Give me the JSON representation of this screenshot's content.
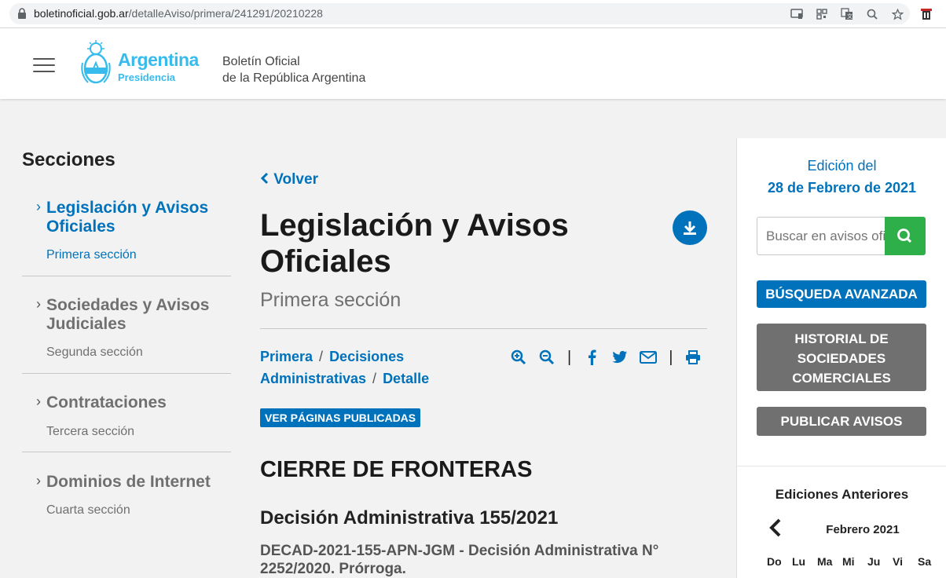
{
  "browser": {
    "url_domain": "boletinoficial.gob.ar",
    "url_path": "/detalleAviso/primera/241291/20210228"
  },
  "header": {
    "logo_title": "Argentina",
    "logo_sub": "Presidencia",
    "site_title_line1": "Boletín Oficial",
    "site_title_line2": "de la República Argentina"
  },
  "sidebar": {
    "title": "Secciones",
    "items": [
      {
        "label": "Legislación y Avisos Oficiales",
        "sub": "Primera sección",
        "active": true
      },
      {
        "label": "Sociedades y Avisos Judiciales",
        "sub": "Segunda sección",
        "active": false
      },
      {
        "label": "Contrataciones",
        "sub": "Tercera sección",
        "active": false
      },
      {
        "label": "Dominios de Internet",
        "sub": "Cuarta sección",
        "active": false
      }
    ]
  },
  "main": {
    "back_label": "Volver",
    "title": "Legislación y Avisos Oficiales",
    "subtitle": "Primera sección",
    "breadcrumb": [
      "Primera",
      "Decisiones Administrativas",
      "Detalle"
    ],
    "pages_button": "VER PÁGINAS PUBLICADAS",
    "heading": "CIERRE DE FRONTERAS",
    "decision": "Decisión Administrativa 155/2021",
    "decad": "DECAD-2021-155-APN-JGM - Decisión Administrativa N° 2252/2020. Prórroga."
  },
  "right_panel": {
    "edition_label": "Edición del",
    "edition_date": "28 de Febrero de 2021",
    "search_placeholder": "Buscar en avisos oficiales",
    "btn_advanced": "BÚSQUEDA AVANZADA",
    "btn_history": "HISTORIAL DE SOCIEDADES COMERCIALES",
    "btn_publish": "PUBLICAR AVISOS",
    "previous_editions": "Ediciones Anteriores",
    "calendar_month": "Febrero 2021",
    "weekdays": [
      "Do",
      "Lu",
      "Ma",
      "Mi",
      "Ju",
      "Vi",
      "Sa"
    ]
  },
  "colors": {
    "primary": "#0072bb",
    "success": "#2eaf49",
    "grey_button": "#707070",
    "logo": "#37bbed"
  },
  "icons": [
    "lock-icon",
    "cast-icon",
    "qr-icon",
    "translate-icon",
    "zoom-icon",
    "star-icon",
    "extension-icon",
    "hamburger-icon",
    "download-icon",
    "zoom-in-icon",
    "zoom-out-icon",
    "facebook-icon",
    "twitter-icon",
    "mail-icon",
    "print-icon",
    "search-icon",
    "chevron-left-icon"
  ]
}
